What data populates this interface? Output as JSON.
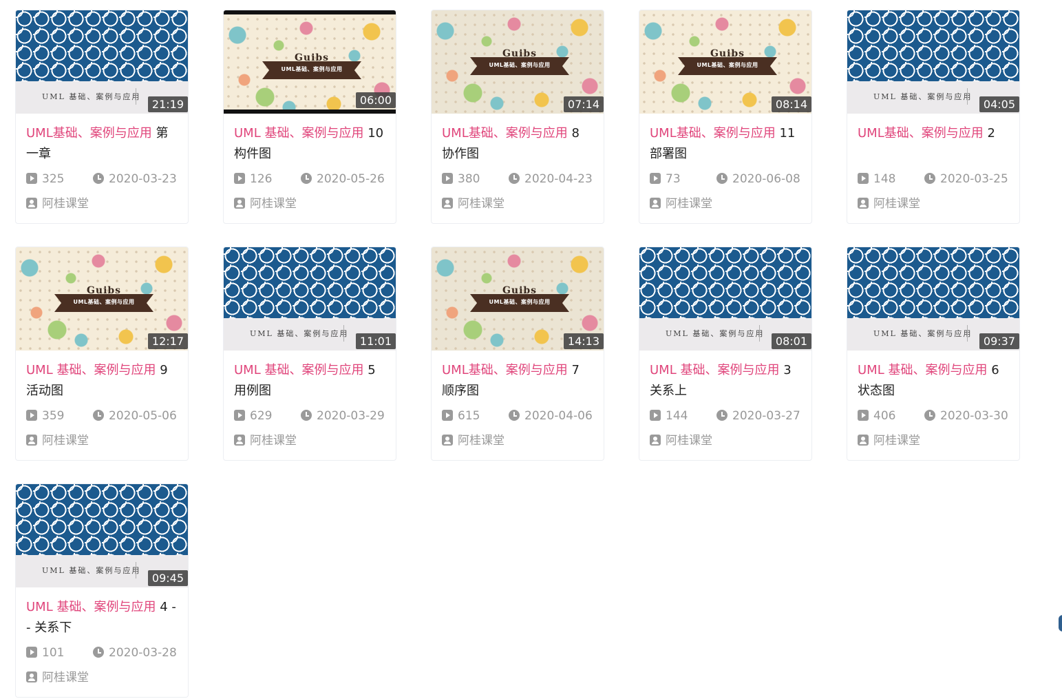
{
  "colors": {
    "highlight": "#e0457b",
    "text": "#222222",
    "meta": "#999999",
    "pattern_blue": "#1c5a8e"
  },
  "icons": {
    "plays": "play-icon",
    "date": "clock-icon",
    "author": "user-icon"
  },
  "videos": [
    {
      "thumb": "pattern",
      "thumb_text": "UML 基础、案例与应用",
      "duration": "21:19",
      "title_hl": "UML基础、案例与应用",
      "title_rest": " 第一章",
      "plays": "325",
      "date": "2020-03-23",
      "author": "阿桂课堂"
    },
    {
      "thumb": "illus-bars",
      "thumb_brand": "Guibs",
      "thumb_sub": "UML基础、案例与应用",
      "duration": "06:00",
      "title_hl": "UML 基础、案例与应用",
      "title_rest": " 10 构件图",
      "plays": "126",
      "date": "2020-05-26",
      "author": "阿桂课堂"
    },
    {
      "thumb": "illus-muted",
      "thumb_brand": "Guibs",
      "thumb_sub": "UML基础、案例与应用",
      "duration": "07:14",
      "title_hl": "UML基础、案例与应用",
      "title_rest": " 8 协作图",
      "plays": "380",
      "date": "2020-04-23",
      "author": "阿桂课堂"
    },
    {
      "thumb": "illus",
      "thumb_brand": "Guibs",
      "thumb_sub": "UML基础、案例与应用",
      "duration": "08:14",
      "title_hl": "UML基础、案例与应用",
      "title_rest": " 11 部署图",
      "plays": "73",
      "date": "2020-06-08",
      "author": "阿桂课堂"
    },
    {
      "thumb": "pattern",
      "thumb_text": "UML 基础、案例与应用",
      "duration": "04:05",
      "title_hl": "UML基础、案例与应用",
      "title_rest": " 2",
      "plays": "148",
      "date": "2020-03-25",
      "author": "阿桂课堂"
    },
    {
      "thumb": "illus",
      "thumb_brand": "Guibs",
      "thumb_sub": "UML基础、案例与应用",
      "duration": "12:17",
      "title_hl": "UML 基础、案例与应用",
      "title_rest": " 9 活动图",
      "plays": "359",
      "date": "2020-05-06",
      "author": "阿桂课堂"
    },
    {
      "thumb": "pattern",
      "thumb_text": "UML 基础、案例与应用",
      "duration": "11:01",
      "title_hl": "UML 基础、案例与应用",
      "title_rest": " 5 用例图",
      "plays": "629",
      "date": "2020-03-29",
      "author": "阿桂课堂"
    },
    {
      "thumb": "illus-muted",
      "thumb_brand": "Guibs",
      "thumb_sub": "UML基础、案例与应用",
      "duration": "14:13",
      "title_hl": "UML基础、案例与应用",
      "title_rest": " 7 顺序图",
      "plays": "615",
      "date": "2020-04-06",
      "author": "阿桂课堂"
    },
    {
      "thumb": "pattern",
      "thumb_text": "UML 基础、案例与应用",
      "duration": "08:01",
      "title_hl": "UML 基础、案例与应用",
      "title_rest": " 3 关系上",
      "plays": "144",
      "date": "2020-03-27",
      "author": "阿桂课堂"
    },
    {
      "thumb": "pattern",
      "thumb_text": "UML 基础、案例与应用",
      "duration": "09:37",
      "title_hl": "UML 基础、案例与应用",
      "title_rest": " 6 状态图",
      "plays": "406",
      "date": "2020-03-30",
      "author": "阿桂课堂"
    },
    {
      "thumb": "pattern",
      "thumb_text": "UML 基础、案例与应用",
      "duration": "09:45",
      "title_hl": "UML 基础、案例与应用",
      "title_rest": " 4 -- 关系下",
      "plays": "101",
      "date": "2020-03-28",
      "author": "阿桂课堂"
    }
  ]
}
